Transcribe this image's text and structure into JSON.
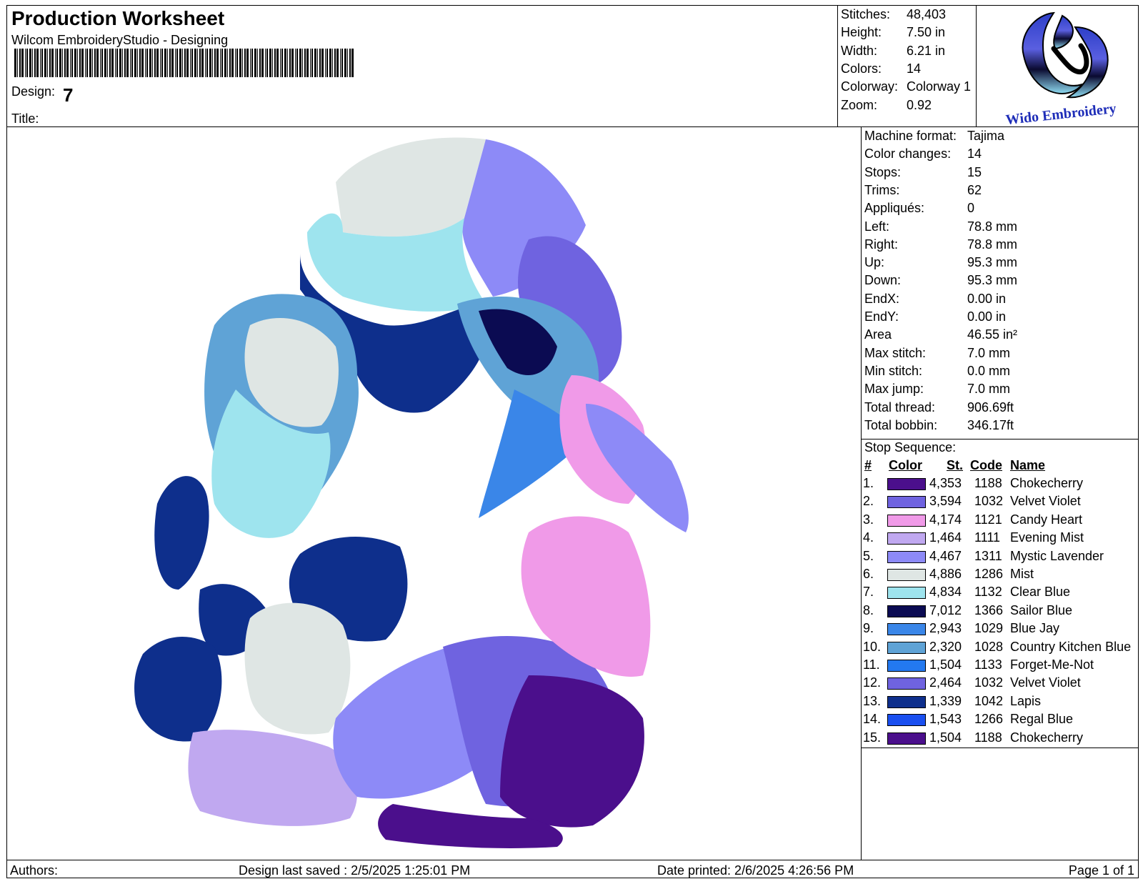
{
  "header": {
    "title": "Production Worksheet",
    "subtitle": "Wilcom EmbroideryStudio - Designing",
    "design_label": "Design:",
    "design_value": "7",
    "title_label": "Title:",
    "logo_text": "Wido Embroidery"
  },
  "summary": [
    {
      "label": "Stitches:",
      "value": "48,403"
    },
    {
      "label": "Height:",
      "value": "7.50 in"
    },
    {
      "label": "Width:",
      "value": "6.21 in"
    },
    {
      "label": "Colors:",
      "value": "14"
    },
    {
      "label": "Colorway:",
      "value": "Colorway 1"
    },
    {
      "label": "Zoom:",
      "value": "0.92"
    }
  ],
  "details": [
    {
      "label": "Machine format:",
      "value": "Tajima"
    },
    {
      "label": "Color changes:",
      "value": "14"
    },
    {
      "label": "Stops:",
      "value": "15"
    },
    {
      "label": "Trims:",
      "value": "62"
    },
    {
      "label": "Appliqués:",
      "value": "0"
    },
    {
      "label": "Left:",
      "value": "78.8 mm"
    },
    {
      "label": "Right:",
      "value": "78.8 mm"
    },
    {
      "label": "Up:",
      "value": "95.3 mm"
    },
    {
      "label": "Down:",
      "value": "95.3 mm"
    },
    {
      "label": "EndX:",
      "value": "0.00 in"
    },
    {
      "label": "EndY:",
      "value": "0.00 in"
    },
    {
      "label": "Area",
      "value": " 46.55 in²"
    },
    {
      "label": "Max stitch:",
      "value": "7.0 mm"
    },
    {
      "label": "Min stitch:",
      "value": "0.0 mm"
    },
    {
      "label": "Max jump:",
      "value": "7.0 mm"
    },
    {
      "label": "Total thread:",
      "value": "906.69ft"
    },
    {
      "label": "Total bobbin:",
      "value": "346.17ft"
    }
  ],
  "stop_sequence": {
    "title": "Stop Sequence:",
    "columns": [
      "#",
      "Color",
      "St.",
      "Code",
      "Name"
    ],
    "rows": [
      {
        "num": "1.",
        "color": "#4b0f8c",
        "st": "4,353",
        "code": "1188",
        "name": "Chokecherry"
      },
      {
        "num": "2.",
        "color": "#6f63e0",
        "st": "3,594",
        "code": "1032",
        "name": "Velvet Violet"
      },
      {
        "num": "3.",
        "color": "#f09ae8",
        "st": "4,174",
        "code": "1121",
        "name": "Candy Heart"
      },
      {
        "num": "4.",
        "color": "#c0a8f0",
        "st": "1,464",
        "code": "1111",
        "name": "Evening Mist"
      },
      {
        "num": "5.",
        "color": "#8d8af7",
        "st": "4,467",
        "code": "1311",
        "name": "Mystic Lavender"
      },
      {
        "num": "6.",
        "color": "#dfe6e4",
        "st": "4,886",
        "code": "1286",
        "name": "Mist"
      },
      {
        "num": "7.",
        "color": "#9ee4ee",
        "st": "4,834",
        "code": "1132",
        "name": "Clear Blue"
      },
      {
        "num": "8.",
        "color": "#0b0b52",
        "st": "7,012",
        "code": "1366",
        "name": "Sailor Blue"
      },
      {
        "num": "9.",
        "color": "#3a86e8",
        "st": "2,943",
        "code": "1029",
        "name": "Blue Jay"
      },
      {
        "num": "10.",
        "color": "#5fa3d6",
        "st": "2,320",
        "code": "1028",
        "name": "Country Kitchen Blue"
      },
      {
        "num": "11.",
        "color": "#2379f0",
        "st": "1,504",
        "code": "1133",
        "name": "Forget-Me-Not"
      },
      {
        "num": "12.",
        "color": "#6f63e0",
        "st": "2,464",
        "code": "1032",
        "name": "Velvet Violet"
      },
      {
        "num": "13.",
        "color": "#0e2f8c",
        "st": "1,339",
        "code": "1042",
        "name": "Lapis"
      },
      {
        "num": "14.",
        "color": "#1a4ff0",
        "st": "1,543",
        "code": "1266",
        "name": "Regal Blue"
      },
      {
        "num": "15.",
        "color": "#4b0f8c",
        "st": "1,504",
        "code": "1188",
        "name": "Chokecherry"
      }
    ]
  },
  "footer": {
    "authors": "Authors:",
    "last_saved": "Design last saved : 2/5/2025 1:25:01 PM",
    "date_printed": "Date printed: 2/6/2025 4:26:56 PM",
    "page": "Page 1 of 1"
  }
}
